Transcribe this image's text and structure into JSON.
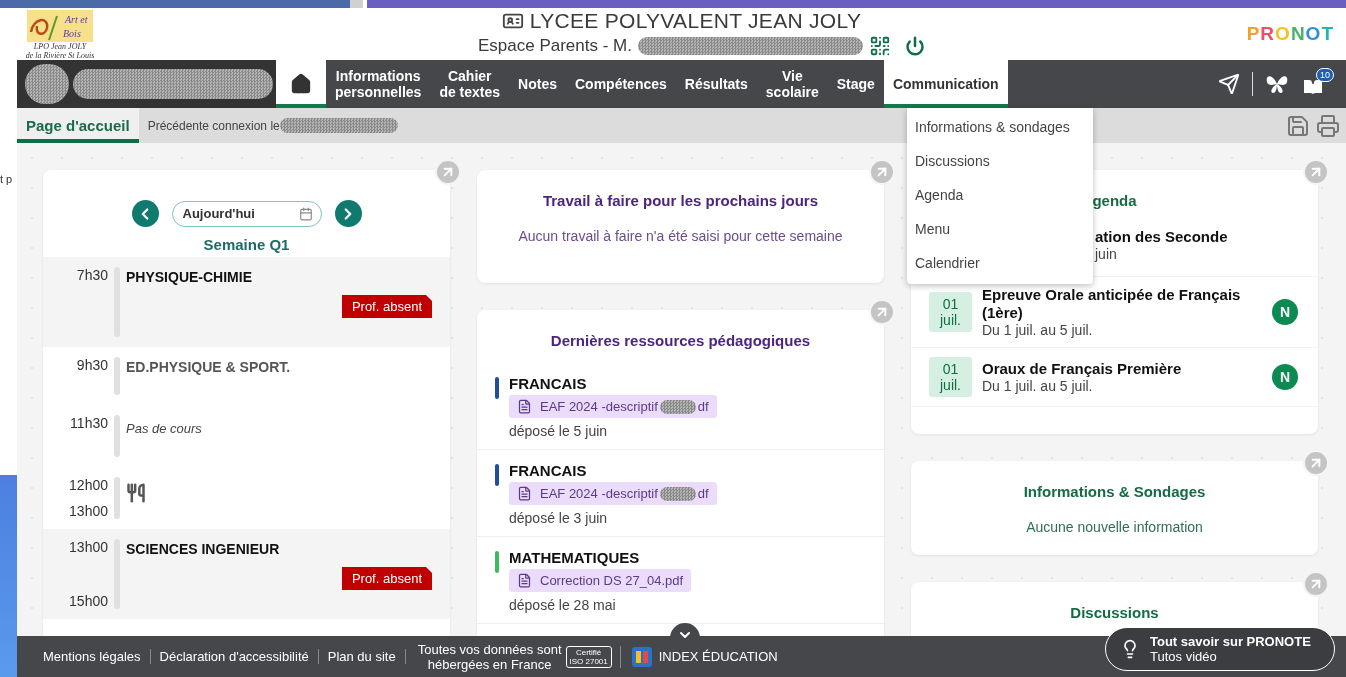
{
  "backdrop": {
    "fragment": "t p"
  },
  "header": {
    "logo_lines": [
      "Art et",
      "Bois",
      "LPO Jean JOLY",
      "de la Rivière St Louis"
    ],
    "school": "LYCEE POLYVALENT JEAN JOLY",
    "space": "Espace Parents - M.",
    "brand": "PRONOT"
  },
  "nav": {
    "items": [
      {
        "kind": "home",
        "selected": true
      },
      {
        "kind": "text",
        "label": "Informations\npersonnelles",
        "selected": false
      },
      {
        "kind": "text",
        "label": "Cahier\nde textes",
        "selected": false
      },
      {
        "kind": "text",
        "label": "Notes",
        "selected": false
      },
      {
        "kind": "text",
        "label": "Compétences",
        "selected": false
      },
      {
        "kind": "text",
        "label": "Résultats",
        "selected": false
      },
      {
        "kind": "text",
        "label": "Vie\nscolaire",
        "selected": false
      },
      {
        "kind": "text",
        "label": "Stage",
        "selected": false
      },
      {
        "kind": "text",
        "label": "Communication",
        "selected": true
      }
    ],
    "badge": "10"
  },
  "subbar": {
    "tabs": [
      {
        "label": "Page d'accueil",
        "selected": true
      }
    ],
    "previous_connection": "Précédente connexion le"
  },
  "menu": {
    "items": [
      {
        "label": "Informations & sondages"
      },
      {
        "label": "Discussions"
      },
      {
        "label": "Agenda"
      },
      {
        "label": "Menu"
      },
      {
        "label": "Calendrier"
      }
    ]
  },
  "schedule": {
    "date_field": "Aujourd'hui",
    "week": "Semaine Q1",
    "slots": [
      {
        "kind": "course",
        "times": [
          "7h30"
        ],
        "subject": "PHYSIQUE-CHIMIE",
        "tag": "Prof. absent",
        "dimmed": false
      },
      {
        "kind": "course",
        "times": [
          "9h30"
        ],
        "subject": "ED.PHYSIQUE & SPORT.",
        "dimmed": true
      },
      {
        "kind": "free",
        "times": [
          "11h30"
        ],
        "note": "Pas de cours"
      },
      {
        "kind": "lunch",
        "times": [
          "12h00",
          "13h00"
        ]
      },
      {
        "kind": "course",
        "times": [
          "13h00",
          "15h00"
        ],
        "subject": "SCIENCES INGENIEUR",
        "tag": "Prof. absent",
        "dimmed": false
      }
    ]
  },
  "homework": {
    "title": "Travail à faire pour les prochains jours",
    "empty": "Aucun travail à faire n'a été saisi pour cette semaine"
  },
  "resources": {
    "title": "Dernières ressources pédagogiques",
    "items": [
      {
        "subject": "FRANCAIS",
        "color": "#1f4e9c",
        "file": [
          "EAF 2024 -descriptif",
          "df"
        ],
        "date": "déposé le 5 juin"
      },
      {
        "subject": "FRANCAIS",
        "color": "#1f4e9c",
        "file": [
          "EAF 2024 -descriptif",
          "df"
        ],
        "date": "déposé le 3 juin"
      },
      {
        "subject": "MATHEMATIQUES",
        "color": "#3dbb5c",
        "file": [
          "Correction DS 27_04.pdf"
        ],
        "date": "déposé le 28 mai"
      }
    ]
  },
  "agenda": {
    "title": "genda",
    "events": [
      {
        "kind": "covered",
        "title": "ation des Seconde",
        "dates": "juin"
      },
      {
        "kind": "full",
        "day": "01",
        "month": "juil.",
        "title": "Epreuve Orale anticipée de Français (1ère)",
        "dates": "Du 1 juil. au 5 juil.",
        "badge": "N"
      },
      {
        "kind": "full",
        "day": "01",
        "month": "juil.",
        "title": "Oraux de Français Première",
        "dates": "Du 1 juil. au 5 juil.",
        "badge": "N"
      }
    ]
  },
  "informations": {
    "title": "Informations & Sondages",
    "empty": "Aucune nouvelle information"
  },
  "discussions": {
    "title": "Discussions"
  },
  "footer": {
    "links": [
      "Mentions légales",
      "Déclaration d'accessibilité",
      "Plan du site"
    ],
    "hosting": "Toutes vos données sont\nhébergées en France",
    "cert": [
      "Certifié",
      "ISO 27001"
    ],
    "publisher": "INDEX ÉDUCATION",
    "help": {
      "title": "Tout savoir sur PRONOTE",
      "subtitle": "Tutos vidéo"
    }
  }
}
